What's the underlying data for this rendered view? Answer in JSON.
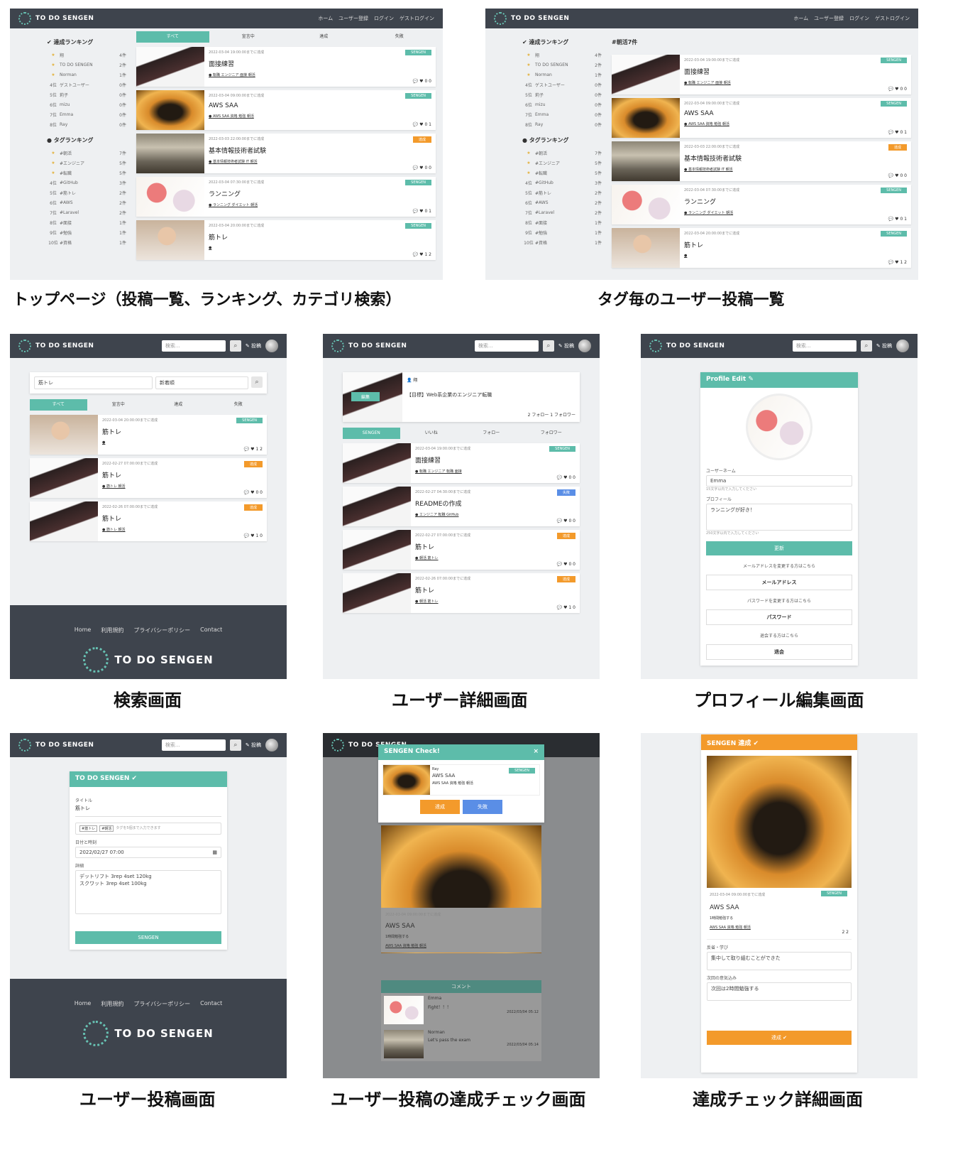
{
  "captions": {
    "top": "トップページ（投稿一覧、ランキング、カテゴリ検索）",
    "tag": "タグ毎のユーザー投稿一覧",
    "search": "検索画面",
    "user_detail": "ユーザー詳細画面",
    "profile_edit": "プロフィール編集画面",
    "user_post": "ユーザー投稿画面",
    "achieve_check": "ユーザー投稿の達成チェック画面",
    "achieve_detail": "達成チェック詳細画面"
  },
  "nav": {
    "brand": "TO DO SENGEN",
    "links": [
      "ホーム",
      "ユーザー登録",
      "ログイン",
      "ゲストログイン"
    ],
    "search_placeholder": "検索...",
    "post_label": "投稿"
  },
  "ranking": {
    "title": "達成ランキング",
    "rows": [
      {
        "pos": "★",
        "name": "翔",
        "count": "4件"
      },
      {
        "pos": "★",
        "name": "TO DO SENGEN",
        "count": "2件"
      },
      {
        "pos": "★",
        "name": "Norman",
        "count": "1件"
      },
      {
        "pos": "4位",
        "name": "ゲストユーザー",
        "count": "0件"
      },
      {
        "pos": "5位",
        "name": "莉子",
        "count": "0件"
      },
      {
        "pos": "6位",
        "name": "mizu",
        "count": "0件"
      },
      {
        "pos": "7位",
        "name": "Emma",
        "count": "0件"
      },
      {
        "pos": "8位",
        "name": "Ray",
        "count": "0件"
      }
    ],
    "tag_title": "タグランキング",
    "tag_rows": [
      {
        "pos": "★",
        "name": "#朝活",
        "count": "7件"
      },
      {
        "pos": "★",
        "name": "#エンジニア",
        "count": "5件"
      },
      {
        "pos": "★",
        "name": "#転職",
        "count": "5件"
      },
      {
        "pos": "4位",
        "name": "#GitHub",
        "count": "3件"
      },
      {
        "pos": "5位",
        "name": "#筋トレ",
        "count": "2件"
      },
      {
        "pos": "6位",
        "name": "#AWS",
        "count": "2件"
      },
      {
        "pos": "7位",
        "name": "#Laravel",
        "count": "2件"
      },
      {
        "pos": "8位",
        "name": "#面接",
        "count": "1件"
      },
      {
        "pos": "9位",
        "name": "#勉強",
        "count": "1件"
      },
      {
        "pos": "10位",
        "name": "#資格",
        "count": "1件"
      }
    ]
  },
  "tabs": [
    "すべて",
    "宣言中",
    "達成",
    "失敗"
  ],
  "tag_header": "#朝活7件",
  "top_posts": [
    {
      "date": "2022-03-04 19:00:00までに達成",
      "title": "面接練習",
      "tags": "転職 エンジニア 面接 朝活",
      "counts": "0  0",
      "badge": "SENGEN",
      "kind": "sengen",
      "thumb": "th-selfie"
    },
    {
      "date": "2022-03-04 09:00:00までに達成",
      "title": "AWS SAA",
      "tags": "AWS SAA 資格 勉強 朝活",
      "counts": "0  1",
      "badge": "SENGEN",
      "kind": "sengen",
      "thumb": "th-sunset"
    },
    {
      "date": "2022-03-03 22:00:00までに達成",
      "title": "基本情報技術者試験",
      "tags": "基本情報技術者試験 IT 朝活",
      "counts": "0  0",
      "badge": "達成",
      "kind": "done",
      "thumb": "th-hall"
    },
    {
      "date": "2022-03-04 07:30:00までに達成",
      "title": "ランニング",
      "tags": "ランニング ダイエット 朝活",
      "counts": "0  1",
      "badge": "SENGEN",
      "kind": "sengen",
      "thumb": "th-flower"
    },
    {
      "date": "2022-03-04 20:00:00までに達成",
      "title": "筋トレ",
      "tags": "",
      "counts": "1  2",
      "badge": "SENGEN",
      "kind": "sengen",
      "thumb": "th-baby"
    }
  ],
  "search": {
    "query": "筋トレ",
    "sort": "新着順",
    "results": [
      {
        "date": "2022-03-04 20:00:00までに達成",
        "title": "筋トレ",
        "tags": "",
        "counts": "1  2",
        "badge": "SENGEN",
        "kind": "sengen",
        "thumb": "th-baby"
      },
      {
        "date": "2022-02-27 07:00:00までに達成",
        "title": "筋トレ",
        "tags": "筋トレ 朝活",
        "counts": "0  0",
        "badge": "達成",
        "kind": "done",
        "thumb": "th-selfie"
      },
      {
        "date": "2022-02-26 07:00:00までに達成",
        "title": "筋トレ",
        "tags": "筋トレ 朝活",
        "counts": "1  0",
        "badge": "達成",
        "kind": "done",
        "thumb": "th-selfie"
      }
    ]
  },
  "footer": {
    "links": [
      "Home",
      "利用規約",
      "プライバシーポリシー",
      "Contact"
    ],
    "brand": "TO DO SENGEN"
  },
  "user_detail": {
    "name": "翔",
    "goal": "【目標】Web系企業のエンジニア転職",
    "follow": "2 フォロー  1 フォロワー",
    "edit": "編集",
    "tabs": [
      "SENGEN",
      "いいね",
      "フォロー",
      "フォロワー"
    ],
    "posts": [
      {
        "date": "2022-03-04 19:00:00までに達成",
        "title": "面接練習",
        "tags": "転職 エンジニア 転職 面接",
        "counts": "0  0",
        "badge": "SENGEN",
        "kind": "sengen",
        "thumb": "th-selfie"
      },
      {
        "date": "2022-02-27 04:30:00までに達成",
        "title": "READMEの作成",
        "tags": "エンジニア 転職 GitHub",
        "counts": "0  0",
        "badge": "失敗",
        "kind": "fail",
        "thumb": "th-selfie"
      },
      {
        "date": "2022-02-27 07:00:00までに達成",
        "title": "筋トレ",
        "tags": "朝活 筋トレ",
        "counts": "0  0",
        "badge": "達成",
        "kind": "done",
        "thumb": "th-selfie"
      },
      {
        "date": "2022-02-26 07:00:00までに達成",
        "title": "筋トレ",
        "tags": "朝活 筋トレ",
        "counts": "1  0",
        "badge": "達成",
        "kind": "done",
        "thumb": "th-selfie"
      }
    ]
  },
  "profile_edit": {
    "title": "Profile Edit",
    "username_label": "ユーザーネーム",
    "username": "Emma",
    "username_hint": "15文字以内で入力してください",
    "profile_label": "プロフィール",
    "profile": "ランニングが好き！",
    "profile_hint": "250文字以内で入力してください",
    "update": "更新",
    "email_note": "メールアドレスを変更する方はこちら",
    "email_btn": "メールアドレス",
    "pw_note": "パスワードを変更する方はこちら",
    "pw_btn": "パスワード",
    "quit_note": "退会する方はこちら",
    "quit_btn": "退会"
  },
  "user_post": {
    "title": "TO DO SENGEN",
    "title_label": "タイトル",
    "title_value": "筋トレ",
    "tags": [
      "#筋トレ",
      "#朝活"
    ],
    "tags_hint": "タグを5個まで入力できます",
    "datetime_label": "日付と時刻",
    "datetime": "2022/02/27 07:00",
    "detail_label": "詳細",
    "detail_line1": "デットリフト 3rep 4set 120kg",
    "detail_line2": "スクワット 3rep 4set 100kg",
    "submit": "SENGEN"
  },
  "achieve_check": {
    "modal_title": "SENGEN Check!",
    "user": "Ray",
    "post_title": "AWS SAA",
    "tags": "AWS SAA 資格 勉強 朝活",
    "done": "達成",
    "fail": "失敗",
    "date": "2022-03-04 09:00:00までに達成",
    "memo": "1時間勉強する",
    "comment_title": "コメント",
    "comments": [
      {
        "user": "Emma",
        "text": "Fight！！！",
        "time": "2022/03/04 05:12"
      },
      {
        "user": "Norman",
        "text": "Let's pass the exam",
        "time": "2022/03/04 05:14"
      }
    ]
  },
  "achieve_detail": {
    "header": "SENGEN 達成",
    "date": "2022-03-04 09:00:00までに達成",
    "badge": "SENGEN",
    "title": "AWS SAA",
    "memo": "1時間勉強する",
    "tags": "AWS SAA 資格 勉強 朝活",
    "counts": "2  2",
    "reflection_label": "反省・学び",
    "reflection": "集中して取り組むことができた",
    "next_label": "次回の意気込み",
    "next": "次回は2時間勉強する",
    "submit": "達成"
  },
  "colors": {
    "teal": "#5dbcaa",
    "orange": "#f39a2b",
    "blue": "#5a8ee6",
    "navy": "#3e444d"
  }
}
